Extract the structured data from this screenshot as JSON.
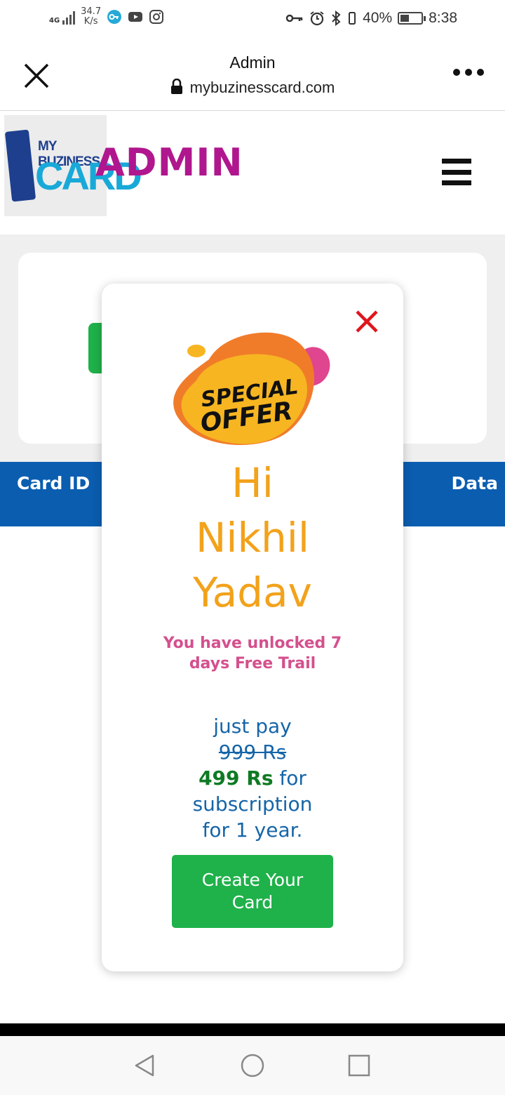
{
  "status_bar": {
    "network": "4G",
    "speed_value": "34.7",
    "speed_unit": "K/s",
    "battery": "40%",
    "time": "8:38"
  },
  "browser": {
    "title": "Admin",
    "url": "mybuzinesscard.com"
  },
  "header": {
    "logo_line1": "MY BUZINESS",
    "logo_line2": "CARD",
    "title": "ADMIN"
  },
  "table": {
    "columns": [
      "Card ID",
      "Data"
    ]
  },
  "modal": {
    "badge_line1": "SPECIAL",
    "badge_line2": "OFFER",
    "greeting": [
      "Hi",
      "Nikhil",
      "Yadav"
    ],
    "unlock_text": "You have unlocked 7 days Free Trail",
    "pay_prefix": "just pay",
    "old_price": "999 Rs",
    "new_price": "499 Rs",
    "pay_suffix_1": " for",
    "pay_suffix_2": "subscription",
    "pay_suffix_3": "for 1 year.",
    "cta_label": "Create Your Card"
  },
  "colors": {
    "admin_title": "#b0168e",
    "table_header": "#0b5db0",
    "greeting": "#f2a21b",
    "unlock": "#d4508d",
    "price_text": "#1565a8",
    "new_price": "#0f7a23",
    "cta": "#1fb14a",
    "close": "#e0151d"
  }
}
